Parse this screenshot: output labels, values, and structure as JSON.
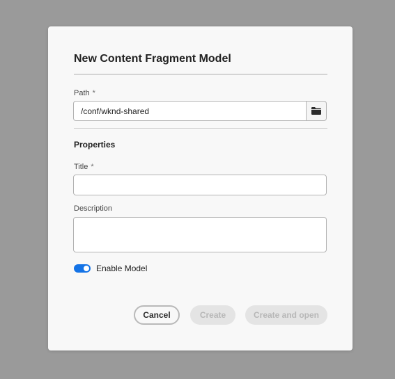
{
  "dialog": {
    "title": "New Content Fragment Model",
    "path": {
      "label": "Path",
      "required_marker": "*",
      "value": "/conf/wknd-shared",
      "browse_icon": "folder-icon"
    },
    "properties_heading": "Properties",
    "title_field": {
      "label": "Title",
      "required_marker": "*",
      "value": ""
    },
    "description_field": {
      "label": "Description",
      "value": ""
    },
    "enable_model": {
      "label": "Enable Model",
      "checked": true
    },
    "buttons": {
      "cancel": "Cancel",
      "create": "Create",
      "create_and_open": "Create and open"
    }
  },
  "colors": {
    "backdrop": "#9a9a9a",
    "dialog_bg": "#f8f8f8",
    "accent": "#1473e6",
    "disabled_bg": "#e4e4e4",
    "disabled_text": "#b7b7b7"
  }
}
